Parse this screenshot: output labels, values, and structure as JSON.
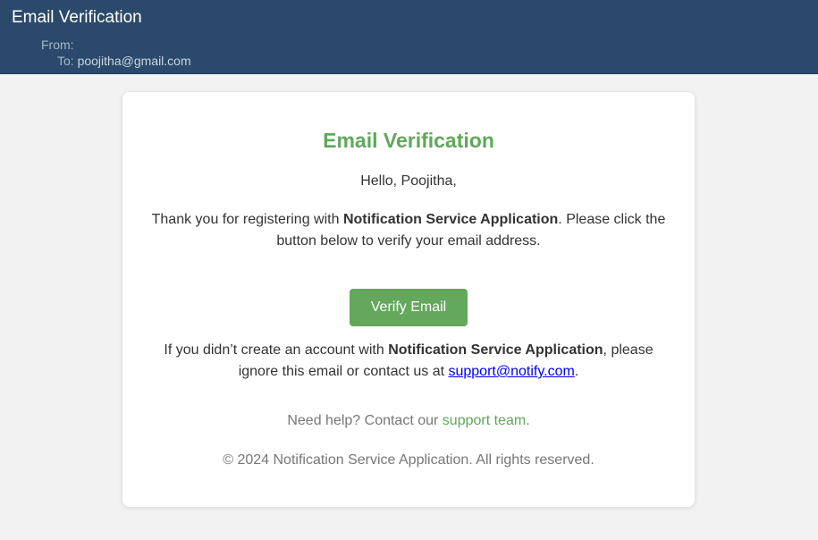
{
  "header": {
    "title": "Email Verification",
    "from_label": "From:",
    "from_value": "",
    "to_label": "To:",
    "to_value": "poojitha@gmail.com"
  },
  "email": {
    "heading": "Email Verification",
    "greeting": "Hello, Poojitha,",
    "p1_before": "Thank you for registering with ",
    "app_name": "Notification Service Application",
    "p1_after": ". Please click the button below to verify your email address.",
    "verify_button": "Verify Email",
    "p2_before": "If you didn’t create an account with ",
    "p2_middle": ", please ignore this email or contact us at ",
    "support_email": "support@notify.com",
    "p2_after": ".",
    "help_before": "Need help? Contact our ",
    "help_link": "support team",
    "help_after": ".",
    "footer": "© 2024 Notification Service Application. All rights reserved."
  },
  "colors": {
    "header_bg": "#2b4a6b",
    "accent_green": "#5fa85a",
    "button_bg": "#63a85c",
    "page_bg": "#f3f2f3"
  }
}
